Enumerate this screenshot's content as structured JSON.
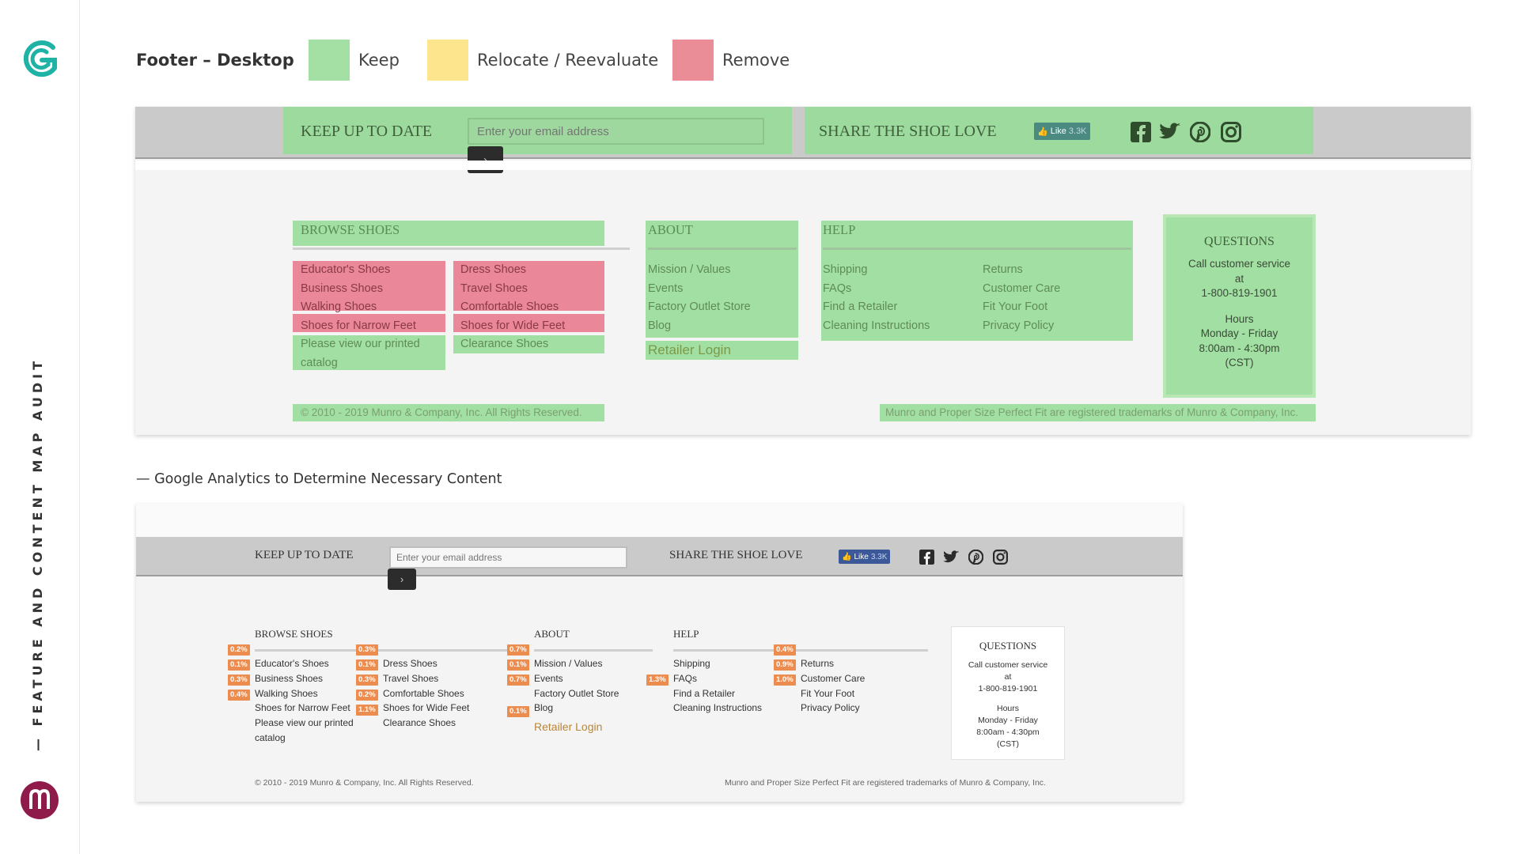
{
  "sidebar": {
    "vertical_title": "— FEATURE AND CONTENT MAP AUDIT",
    "logo_top": "logo-g",
    "logo_bottom": "logo-m"
  },
  "legend": {
    "title": "Footer – Desktop",
    "keep": {
      "label": "Keep",
      "color": "#a4e0a4"
    },
    "relocate": {
      "label": "Relocate / Reevaluate",
      "color": "#fde58e"
    },
    "remove": {
      "label": "Remove",
      "color": "#ea8d97"
    }
  },
  "audit": {
    "keep_up_label": "KEEP UP TO DATE",
    "email_placeholder": "Enter your email address",
    "share_label": "SHARE THE SHOE LOVE",
    "like_label": "Like",
    "like_count": "3.3K",
    "browse": {
      "title": "BROWSE SHOES",
      "col1": [
        "Educator's Shoes",
        "Business Shoes",
        "Walking Shoes",
        "Shoes for Narrow Feet",
        "Please view our printed catalog"
      ],
      "col2": [
        "Dress Shoes",
        "Travel Shoes",
        "Comfortable Shoes",
        "Shoes for Wide Feet",
        "Clearance Shoes"
      ]
    },
    "about": {
      "title": "ABOUT",
      "items": [
        "Mission / Values",
        "Events",
        "Factory Outlet Store",
        "Blog"
      ],
      "retailer_login": "Retailer Login"
    },
    "help": {
      "title": "HELP",
      "col1": [
        "Shipping",
        "FAQs",
        "Find a Retailer",
        "Cleaning Instructions"
      ],
      "col2": [
        "Returns",
        "Customer Care",
        "Fit Your Foot",
        "Privacy Policy"
      ]
    },
    "questions": {
      "title": "QUESTIONS",
      "call1": "Call customer service",
      "call2": "at",
      "phone": "1-800-819-1901",
      "hours": "Hours",
      "days": "Monday - Friday",
      "time": "8:00am - 4:30pm",
      "tz": "(CST)"
    },
    "copyright": "© 2010 - 2019 Munro & Company, Inc. All Rights Reserved.",
    "trademark": "Munro and Proper Size Perfect Fit are registered trademarks of Munro & Company, Inc."
  },
  "analytics": {
    "heading": "— Google Analytics to Determine Necessary Content",
    "browse_header_badge": "0.2%",
    "browse_col1_badges": [
      "0.1%",
      "0.3%",
      "0.4%"
    ],
    "browse_col2_header_badge": "0.3%",
    "browse_col2_badges": [
      "0.1%",
      "0.3%",
      "0.2%",
      "1.1%"
    ],
    "about_header_badge": "0.7%",
    "about_badges": [
      "0.1%",
      "0.7%"
    ],
    "blog_badge": "0.1%",
    "faqs_badge": "1.3%",
    "help2_header_badge": "0.4%",
    "help2_badges": [
      "0.9%",
      "1.0%"
    ]
  }
}
